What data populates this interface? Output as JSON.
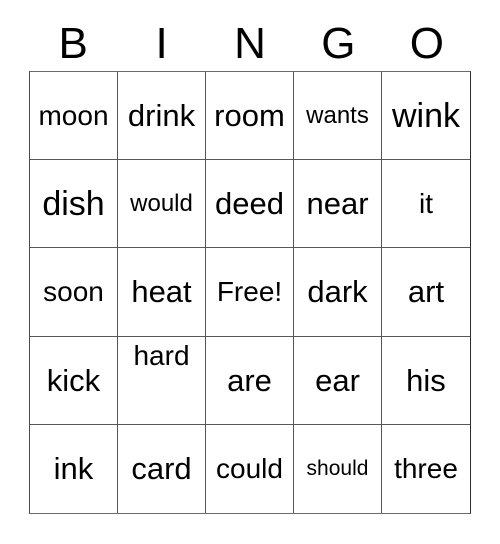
{
  "card": {
    "title": "BINGO",
    "header_letters": [
      "B",
      "I",
      "N",
      "G",
      "O"
    ],
    "free_space_label": "Free!",
    "grid_size": "5x5",
    "colors": {
      "text": "#000000",
      "background": "#ffffff",
      "border": "#575757"
    },
    "rows": [
      {
        "cells": [
          {
            "text": "moon",
            "size": "fs-md",
            "align": "center"
          },
          {
            "text": "drink",
            "size": "fs-lg",
            "align": "center"
          },
          {
            "text": "room",
            "size": "fs-lg",
            "align": "center"
          },
          {
            "text": "wants",
            "size": "fs-sm",
            "align": "center"
          },
          {
            "text": "wink",
            "size": "fs-xl",
            "align": "center"
          }
        ]
      },
      {
        "cells": [
          {
            "text": "dish",
            "size": "fs-xl",
            "align": "center"
          },
          {
            "text": "would",
            "size": "fs-sm",
            "align": "center"
          },
          {
            "text": "deed",
            "size": "fs-lg",
            "align": "center"
          },
          {
            "text": "near",
            "size": "fs-lg",
            "align": "center"
          },
          {
            "text": "it",
            "size": "fs-md",
            "align": "center"
          }
        ]
      },
      {
        "cells": [
          {
            "text": "soon",
            "size": "fs-md",
            "align": "center"
          },
          {
            "text": "heat",
            "size": "fs-lg",
            "align": "center"
          },
          {
            "text": "Free!",
            "size": "fs-md",
            "align": "center"
          },
          {
            "text": "dark",
            "size": "fs-lg",
            "align": "center"
          },
          {
            "text": "art",
            "size": "fs-lg",
            "align": "center"
          }
        ]
      },
      {
        "cells": [
          {
            "text": "kick",
            "size": "fs-lg",
            "align": "center"
          },
          {
            "text": "hard",
            "size": "fs-md",
            "align": "top"
          },
          {
            "text": "are",
            "size": "fs-lg",
            "align": "center"
          },
          {
            "text": "ear",
            "size": "fs-lg",
            "align": "center"
          },
          {
            "text": "his",
            "size": "fs-lg",
            "align": "center"
          }
        ]
      },
      {
        "cells": [
          {
            "text": "ink",
            "size": "fs-lg",
            "align": "center"
          },
          {
            "text": "card",
            "size": "fs-lg",
            "align": "center"
          },
          {
            "text": "could",
            "size": "fs-md",
            "align": "center"
          },
          {
            "text": "should",
            "size": "fs-xs",
            "align": "center"
          },
          {
            "text": "three",
            "size": "fs-md",
            "align": "center"
          }
        ]
      }
    ]
  }
}
